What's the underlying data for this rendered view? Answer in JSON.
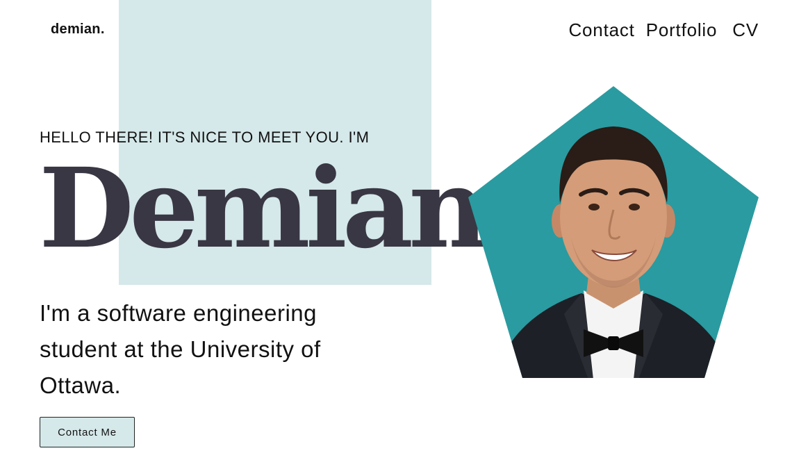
{
  "brand": {
    "logo": "demian."
  },
  "nav": {
    "items": [
      {
        "label": "Contact"
      },
      {
        "label": "Portfolio"
      },
      {
        "label": "CV"
      }
    ]
  },
  "hero": {
    "greeting": "HELLO THERE! IT'S NICE TO MEET YOU. I'M",
    "name": "Demian",
    "intro_lines": [
      "I'm a software engineering",
      "student at the University of",
      "Ottawa."
    ],
    "cta_label": "Contact Me"
  },
  "colors": {
    "accent_light": "#d5e8ea",
    "pentagon_teal": "#2a9ba0",
    "name_color": "#393743",
    "text": "#111111"
  },
  "icons": {
    "portrait": "profile-photo-pentagon"
  }
}
